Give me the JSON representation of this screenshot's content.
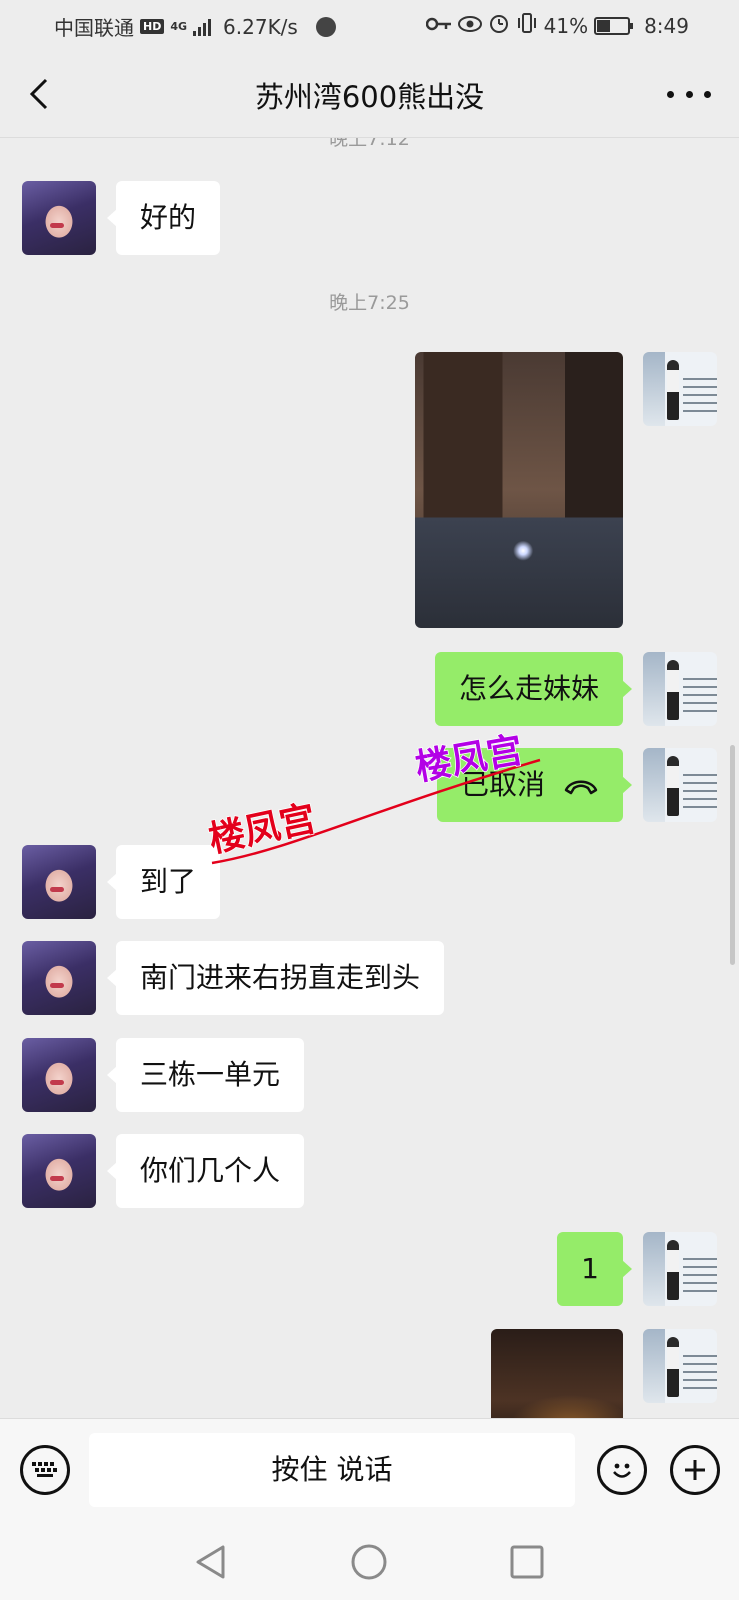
{
  "status_bar": {
    "carrier": "中国联通",
    "hd_badge": "HD",
    "network": "4G",
    "speed": "6.27K/s",
    "battery": "41%",
    "time": "8:49",
    "icons": [
      "key-icon",
      "eye-icon",
      "alarm-icon",
      "vibrate-icon",
      "battery-icon"
    ]
  },
  "header": {
    "title": "苏州湾600熊出没"
  },
  "chat": {
    "partial_time": "晚上7:12",
    "messages_before": [
      {
        "side": "in",
        "text": "好的"
      }
    ],
    "time_2": "晚上7:25",
    "outgoing_text_1": "怎么走妹妹",
    "call_status": "已取消",
    "incoming": [
      {
        "text": "到了"
      },
      {
        "text": "南门进来右拐直走到头"
      },
      {
        "text": "三栋一单元"
      },
      {
        "text": "你们几个人"
      }
    ],
    "outgoing_text_2": "1"
  },
  "watermarks": [
    "楼凤宫",
    "楼凤宫"
  ],
  "input_bar": {
    "voice_label": "按住 说话"
  },
  "colors": {
    "background": "#ededed",
    "outgoing_bubble": "#95ec69",
    "incoming_bubble": "#ffffff",
    "watermark_red": "#e3001b",
    "watermark_purple": "#b300e6"
  }
}
